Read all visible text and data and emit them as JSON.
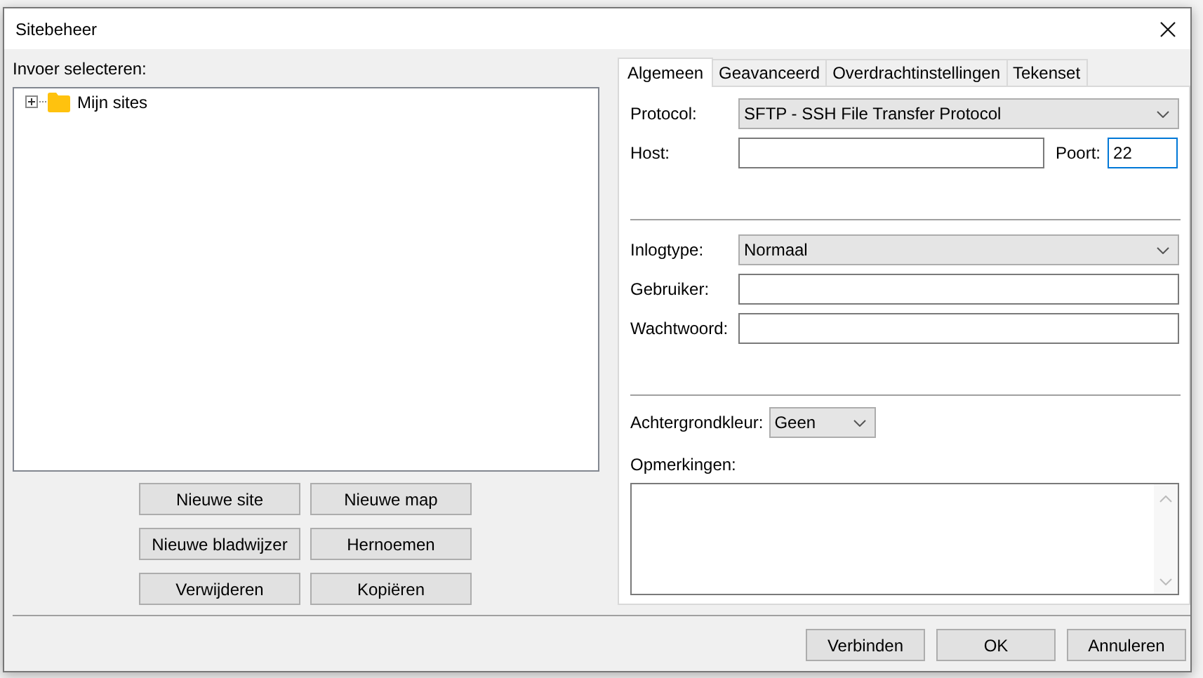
{
  "window": {
    "title": "Sitebeheer"
  },
  "site_tree": {
    "label": "Invoer selecteren:",
    "items": [
      {
        "label": "Mijn sites",
        "expanded": false
      }
    ]
  },
  "site_buttons": [
    "Nieuwe site",
    "Nieuwe map",
    "Nieuwe bladwijzer",
    "Hernoemen",
    "Verwijderen",
    "Kopiëren"
  ],
  "tabs": [
    {
      "label": "Algemeen",
      "selected": true
    },
    {
      "label": "Geavanceerd",
      "selected": false
    },
    {
      "label": "Overdrachtinstellingen",
      "selected": false
    },
    {
      "label": "Tekenset",
      "selected": false
    }
  ],
  "protocol": {
    "label": "Protocol:",
    "value": "SFTP - SSH File Transfer Protocol"
  },
  "host": {
    "label": "Host:"
  },
  "port": {
    "label": "Poort:",
    "value": "22",
    "focused": true
  },
  "logon_type": {
    "label": "Inlogtype:",
    "value": "Normaal"
  },
  "user": {
    "label": "Gebruiker:"
  },
  "password": {
    "label": "Wachtwoord:"
  },
  "background_color": {
    "label": "Achtergrondkleur:",
    "value": "Geen"
  },
  "comments": {
    "label": "Opmerkingen:"
  },
  "dialog_buttons": [
    "Verbinden",
    "OK",
    "Annuleren"
  ]
}
